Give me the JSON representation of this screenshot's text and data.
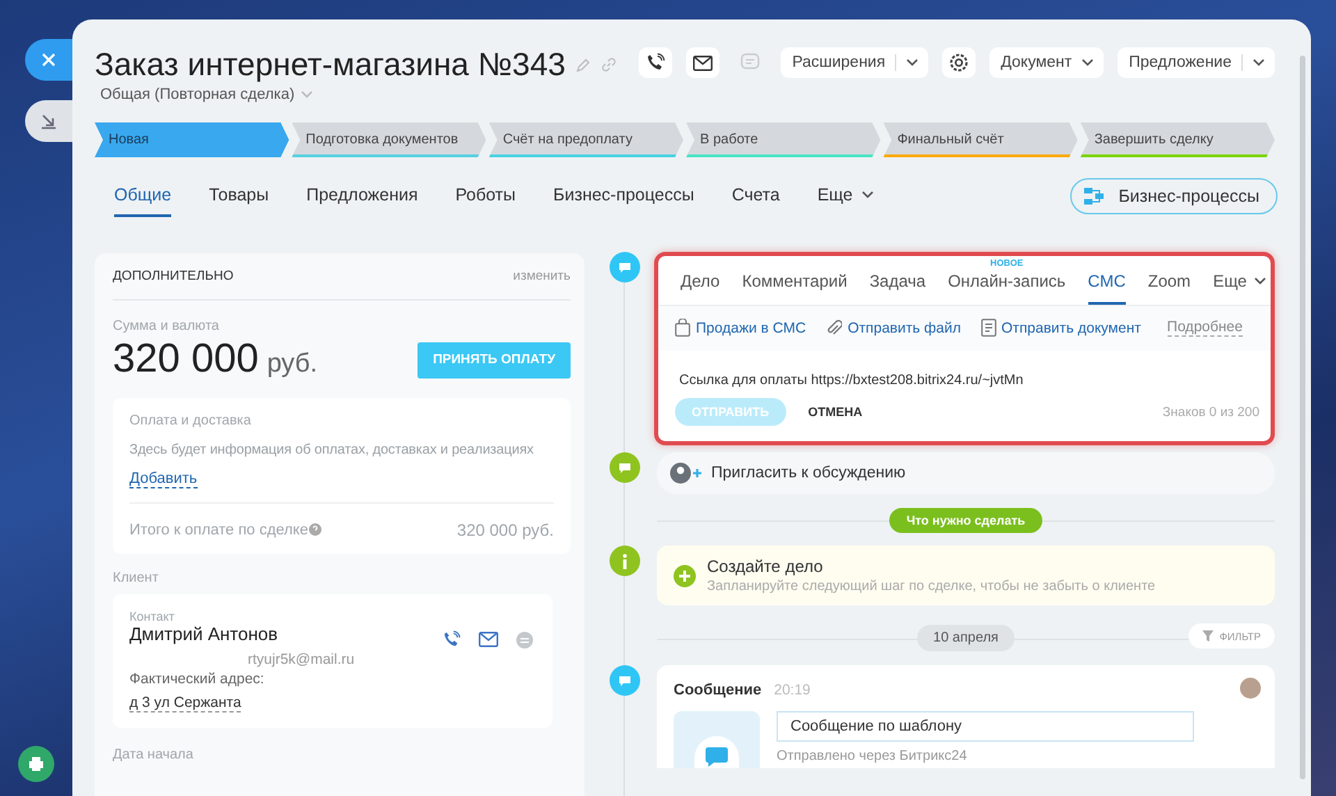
{
  "header": {
    "title": "Заказ интернет-магазина №343",
    "subtitle": "Общая (Повторная сделка)",
    "toolbar": [
      {
        "kind": "icon",
        "disabled": false
      },
      {
        "kind": "icon",
        "disabled": false
      },
      {
        "kind": "icon",
        "disabled": true
      },
      {
        "kind": "split",
        "label": "Расширения"
      },
      {
        "kind": "icon",
        "disabled": false
      },
      {
        "kind": "dropdown",
        "label": "Документ"
      },
      {
        "kind": "split",
        "label": "Предложение"
      }
    ]
  },
  "stages": [
    {
      "label": "Новая",
      "selected": true,
      "color": "#39a8ef"
    },
    {
      "label": "Подготовка документов",
      "selected": false,
      "color": "#55d0e0"
    },
    {
      "label": "Счёт на предоплату",
      "selected": false,
      "color": "#47d1e2"
    },
    {
      "label": "В работе",
      "selected": false,
      "color": "#47e4c2"
    },
    {
      "label": "Финальный счёт",
      "selected": false,
      "color": "#ffa900"
    },
    {
      "label": "Завершить сделку",
      "selected": false,
      "color": "#7bd500"
    }
  ],
  "tabs": [
    {
      "label": "Общие",
      "selected": true,
      "kind": "plain"
    },
    {
      "label": "Товары",
      "selected": false,
      "kind": "plain"
    },
    {
      "label": "Предложения",
      "selected": false,
      "kind": "plain"
    },
    {
      "label": "Роботы",
      "selected": false,
      "kind": "plain"
    },
    {
      "label": "Бизнес-процессы",
      "selected": false,
      "kind": "plain"
    },
    {
      "label": "Счета",
      "selected": false,
      "kind": "plain"
    },
    {
      "label": "Еще",
      "selected": false,
      "kind": "more"
    }
  ],
  "process_button": "Бизнес-процессы",
  "details": {
    "title": "ДОПОЛНИТЕЛЬНО",
    "edit_link": "изменить",
    "amount_label": "Сумма и валюта",
    "amount": "320 000",
    "currency": "руб.",
    "pay_button": "ПРИНЯТЬ ОПЛАТУ",
    "payment": {
      "title": "Оплата и доставка",
      "info": "Здесь будет информация об оплатах, доставках и реализациях",
      "add_link": "Добавить",
      "total_label": "Итого к оплате по сделке",
      "total_value": "320 000 руб."
    },
    "client_label": "Клиент",
    "contact": {
      "label": "Контакт",
      "name": "Дмитрий Антонов",
      "email": "rtyujr5k@mail.ru",
      "address_label": "Фактический адрес:",
      "address": "д 3 ул Сержанта"
    },
    "date_label": "Дата начала"
  },
  "editor": {
    "highlighted": true,
    "tabs": [
      {
        "label": "Дело",
        "selected": false,
        "kind": "plain"
      },
      {
        "label": "Комментарий",
        "selected": false,
        "kind": "plain"
      },
      {
        "label": "Задача",
        "selected": false,
        "kind": "plain"
      },
      {
        "label": "Онлайн-запись",
        "selected": false,
        "kind": "plain",
        "badge": "НОВОЕ"
      },
      {
        "label": "СМС",
        "selected": true,
        "kind": "plain"
      },
      {
        "label": "Zoom",
        "selected": false,
        "kind": "plain"
      },
      {
        "label": "Еще",
        "selected": false,
        "kind": "more"
      }
    ],
    "actions": [
      {
        "label": "Продажи в СМС"
      },
      {
        "label": "Отправить файл"
      },
      {
        "label": "Отправить документ"
      }
    ],
    "more_link": "Подробнее",
    "message": "Ссылка для оплаты https://bxtest208.bitrix24.ru/~jvtMn",
    "send_button": {
      "label": "ОТПРАВИТЬ",
      "disabled": true
    },
    "cancel_button": "ОТМЕНА",
    "counter": "Знаков 0 из 200"
  },
  "invite": "Пригласить к обсуждению",
  "todo_pill": "Что нужно сделать",
  "todo": {
    "title": "Создайте дело",
    "hint": "Запланируйте следующий шаг по сделке, чтобы не забыть о клиенте"
  },
  "date_pill": "10 апреля",
  "filter_button": "ФИЛЬТР",
  "message_item": {
    "title": "Сообщение",
    "time": "20:19",
    "bubble": "Сообщение по шаблону",
    "footer": "Отправлено через Битрикс24"
  }
}
